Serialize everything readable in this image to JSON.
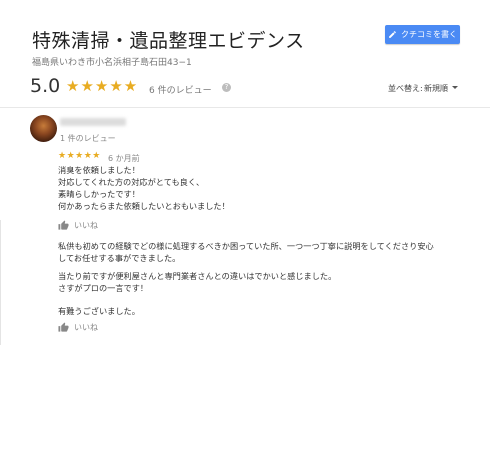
{
  "business": {
    "name": "特殊清掃・遺品整理エビデンス",
    "address": "福島県いわき市小名浜相子島石田43−1",
    "write_review_label": "クチコミを書く"
  },
  "summary": {
    "rating": "5.0",
    "stars": "★★★★★",
    "review_count": "6 件のレビュー",
    "help": "?"
  },
  "sort": {
    "label": "並べ替え:",
    "value": "新規順"
  },
  "review": {
    "reviewer_meta": "1 件のレビュー",
    "stars": "★★★★★",
    "time": "6 か月前",
    "paragraph1": [
      "消臭を依頼しました！",
      "対応してくれた方の対応がとても良く、",
      "素晴らしかったです！",
      "何かあったらまた依頼したいとおもいました！"
    ],
    "like_label": "いいね",
    "owner_paragraphs": [
      "私供も初めての経験でどの様に処理するべきか困っていた所、一つ一つ丁寧に説明をしてくださり安心",
      "してお任せする事ができました。",
      "",
      "当たり前ですが便利屋さんと専門業者さんとの違いはでかいと感じました。",
      "さすがプロの一言です！",
      "",
      "有難うございました。"
    ],
    "like_label_2": "いいね"
  },
  "colors": {
    "accent_button": "#4a8af4",
    "star": "#e8ac22"
  }
}
